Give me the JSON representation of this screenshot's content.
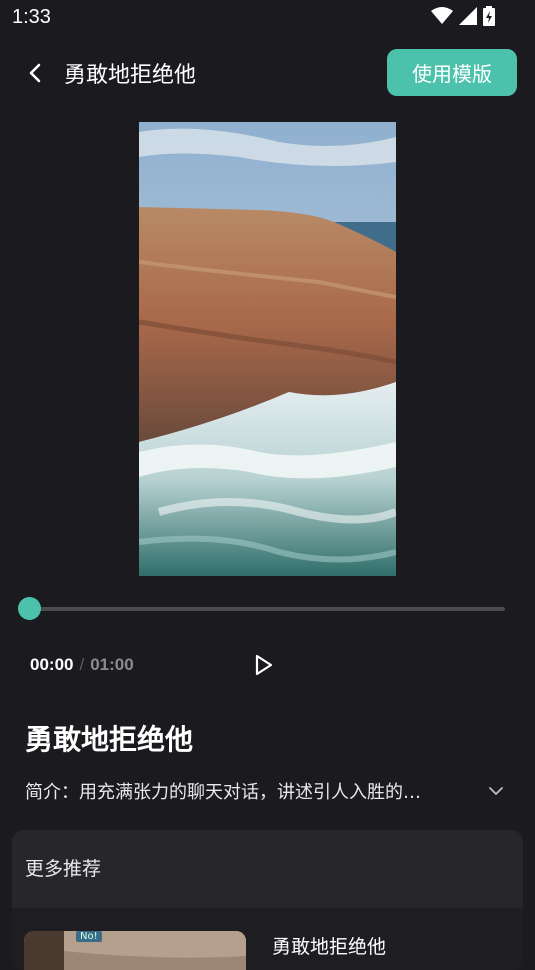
{
  "status": {
    "time": "1:33"
  },
  "header": {
    "title": "勇敢地拒绝他",
    "use_template_label": "使用模版"
  },
  "player": {
    "current_time": "00:00",
    "separator": "/",
    "total_time": "01:00",
    "progress": 0
  },
  "detail": {
    "title": "勇敢地拒绝他",
    "intro": "简介：用充满张力的聊天对话，讲述引人入胜的…"
  },
  "more": {
    "section_title": "更多推荐",
    "items": [
      {
        "title": "勇敢地拒绝他",
        "badge": "No!"
      }
    ]
  },
  "colors": {
    "accent": "#4cc2ad",
    "background": "#1b1b1f",
    "panel": "#26262b"
  }
}
